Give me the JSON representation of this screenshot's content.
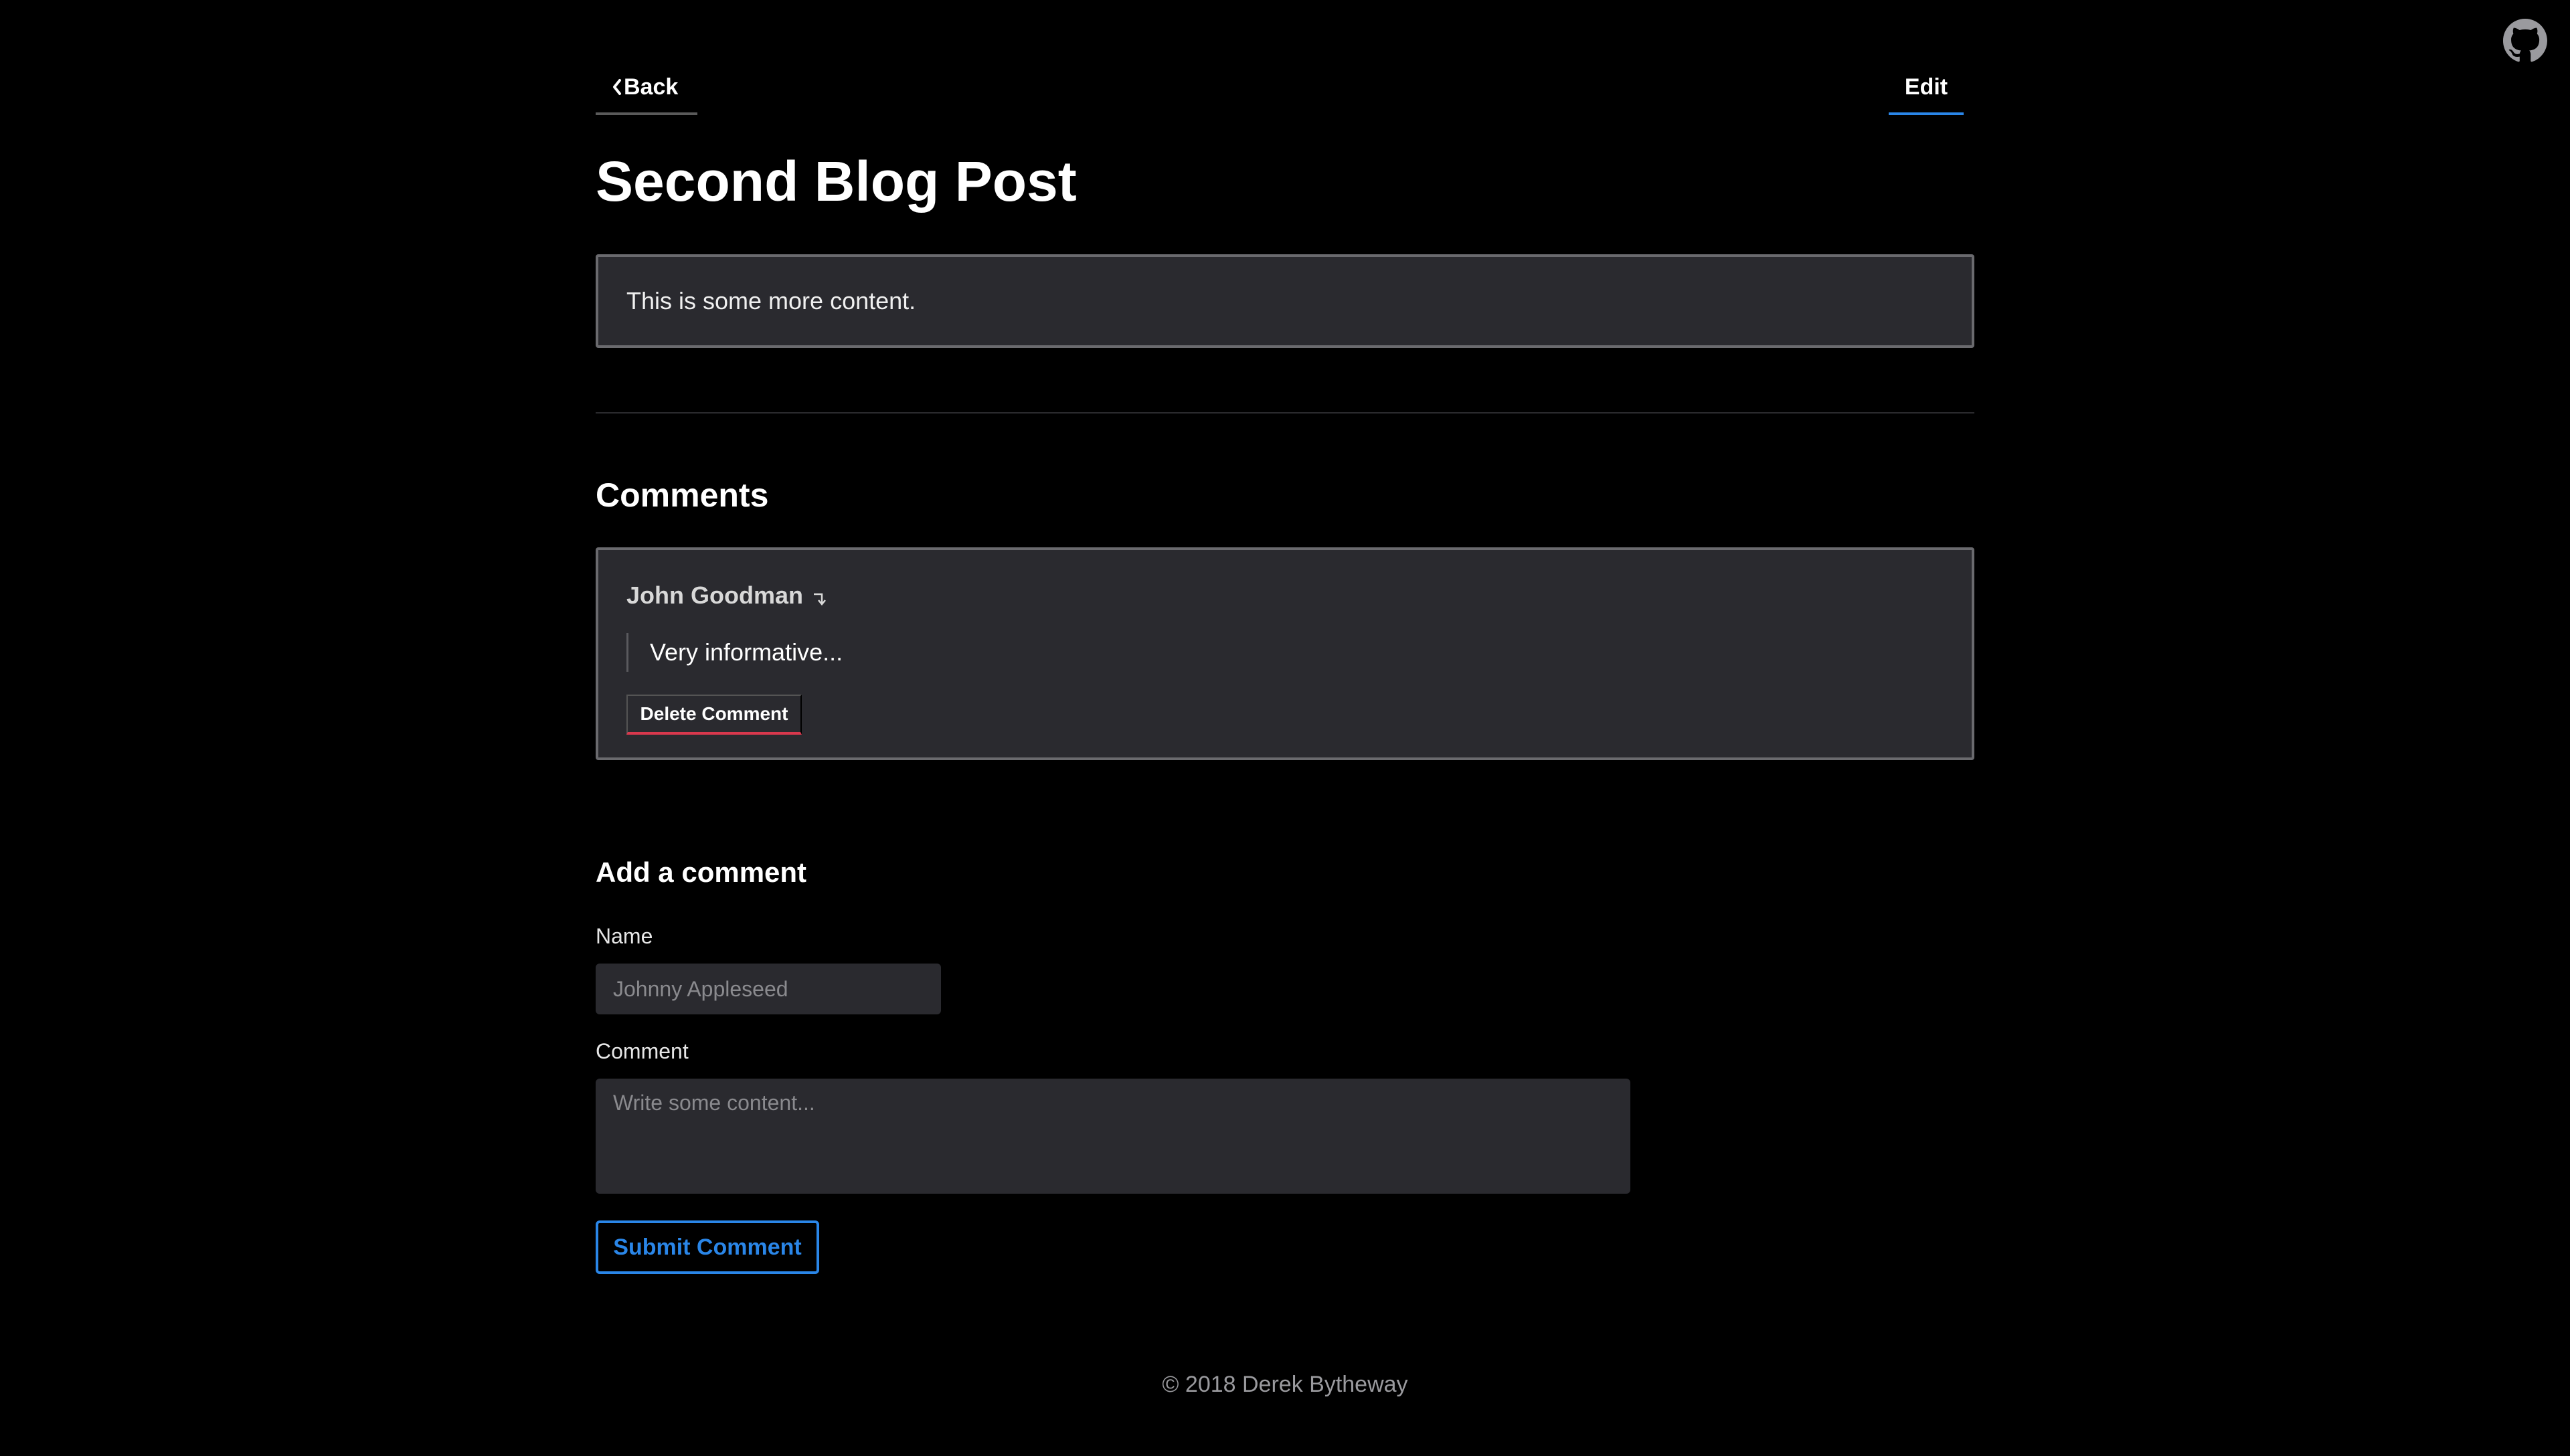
{
  "header": {
    "back_label": "Back",
    "edit_label": "Edit",
    "github_icon": "github-icon"
  },
  "post": {
    "title": "Second Blog Post",
    "content": "This is some more content."
  },
  "comments": {
    "heading": "Comments",
    "items": [
      {
        "author": "John Goodman",
        "text": "Very informative...",
        "delete_label": "Delete Comment"
      }
    ]
  },
  "add_comment": {
    "heading": "Add a comment",
    "name_label": "Name",
    "name_placeholder": "Johnny Appleseed",
    "name_value": "",
    "comment_label": "Comment",
    "comment_placeholder": "Write some content...",
    "comment_value": "",
    "submit_label": "Submit Comment"
  },
  "footer": {
    "text": "© 2018 Derek Bytheway"
  },
  "colors": {
    "background": "#000000",
    "card": "#2a2a2f",
    "accent_blue": "#2a86e8",
    "danger_red": "#d9384d"
  }
}
